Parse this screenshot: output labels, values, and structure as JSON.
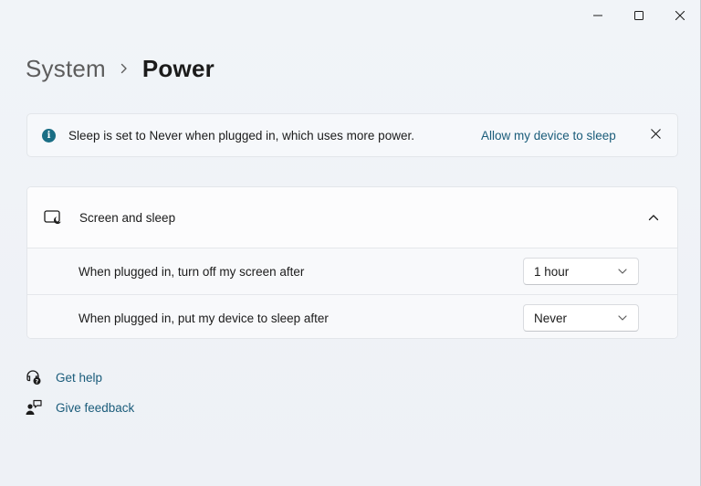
{
  "window": {
    "controls": {
      "minimize_icon": "minimize-icon",
      "maximize_icon": "maximize-icon",
      "close_icon": "close-icon"
    }
  },
  "breadcrumb": {
    "parent": "System",
    "separator_icon": "chevron-right-icon",
    "current": "Power"
  },
  "infobar": {
    "icon": "info-icon",
    "icon_glyph": "i",
    "message": "Sleep is set to Never when plugged in, which uses more power.",
    "action_link": "Allow my device to sleep",
    "dismiss_icon": "close-icon"
  },
  "screen_and_sleep": {
    "icon": "screen-sleep-icon",
    "title": "Screen and sleep",
    "expanded": true,
    "collapse_icon": "chevron-up-icon",
    "rows": [
      {
        "label": "When plugged in, turn off my screen after",
        "value": "1 hour"
      },
      {
        "label": "When plugged in, put my device to sleep after",
        "value": "Never"
      }
    ]
  },
  "help_links": [
    {
      "icon": "help-icon",
      "label": "Get help"
    },
    {
      "icon": "feedback-icon",
      "label": "Give feedback"
    }
  ],
  "colors": {
    "accent": "#1a5c7a",
    "info_icon_bg": "#1a6e85",
    "background": "#eef1f6"
  }
}
